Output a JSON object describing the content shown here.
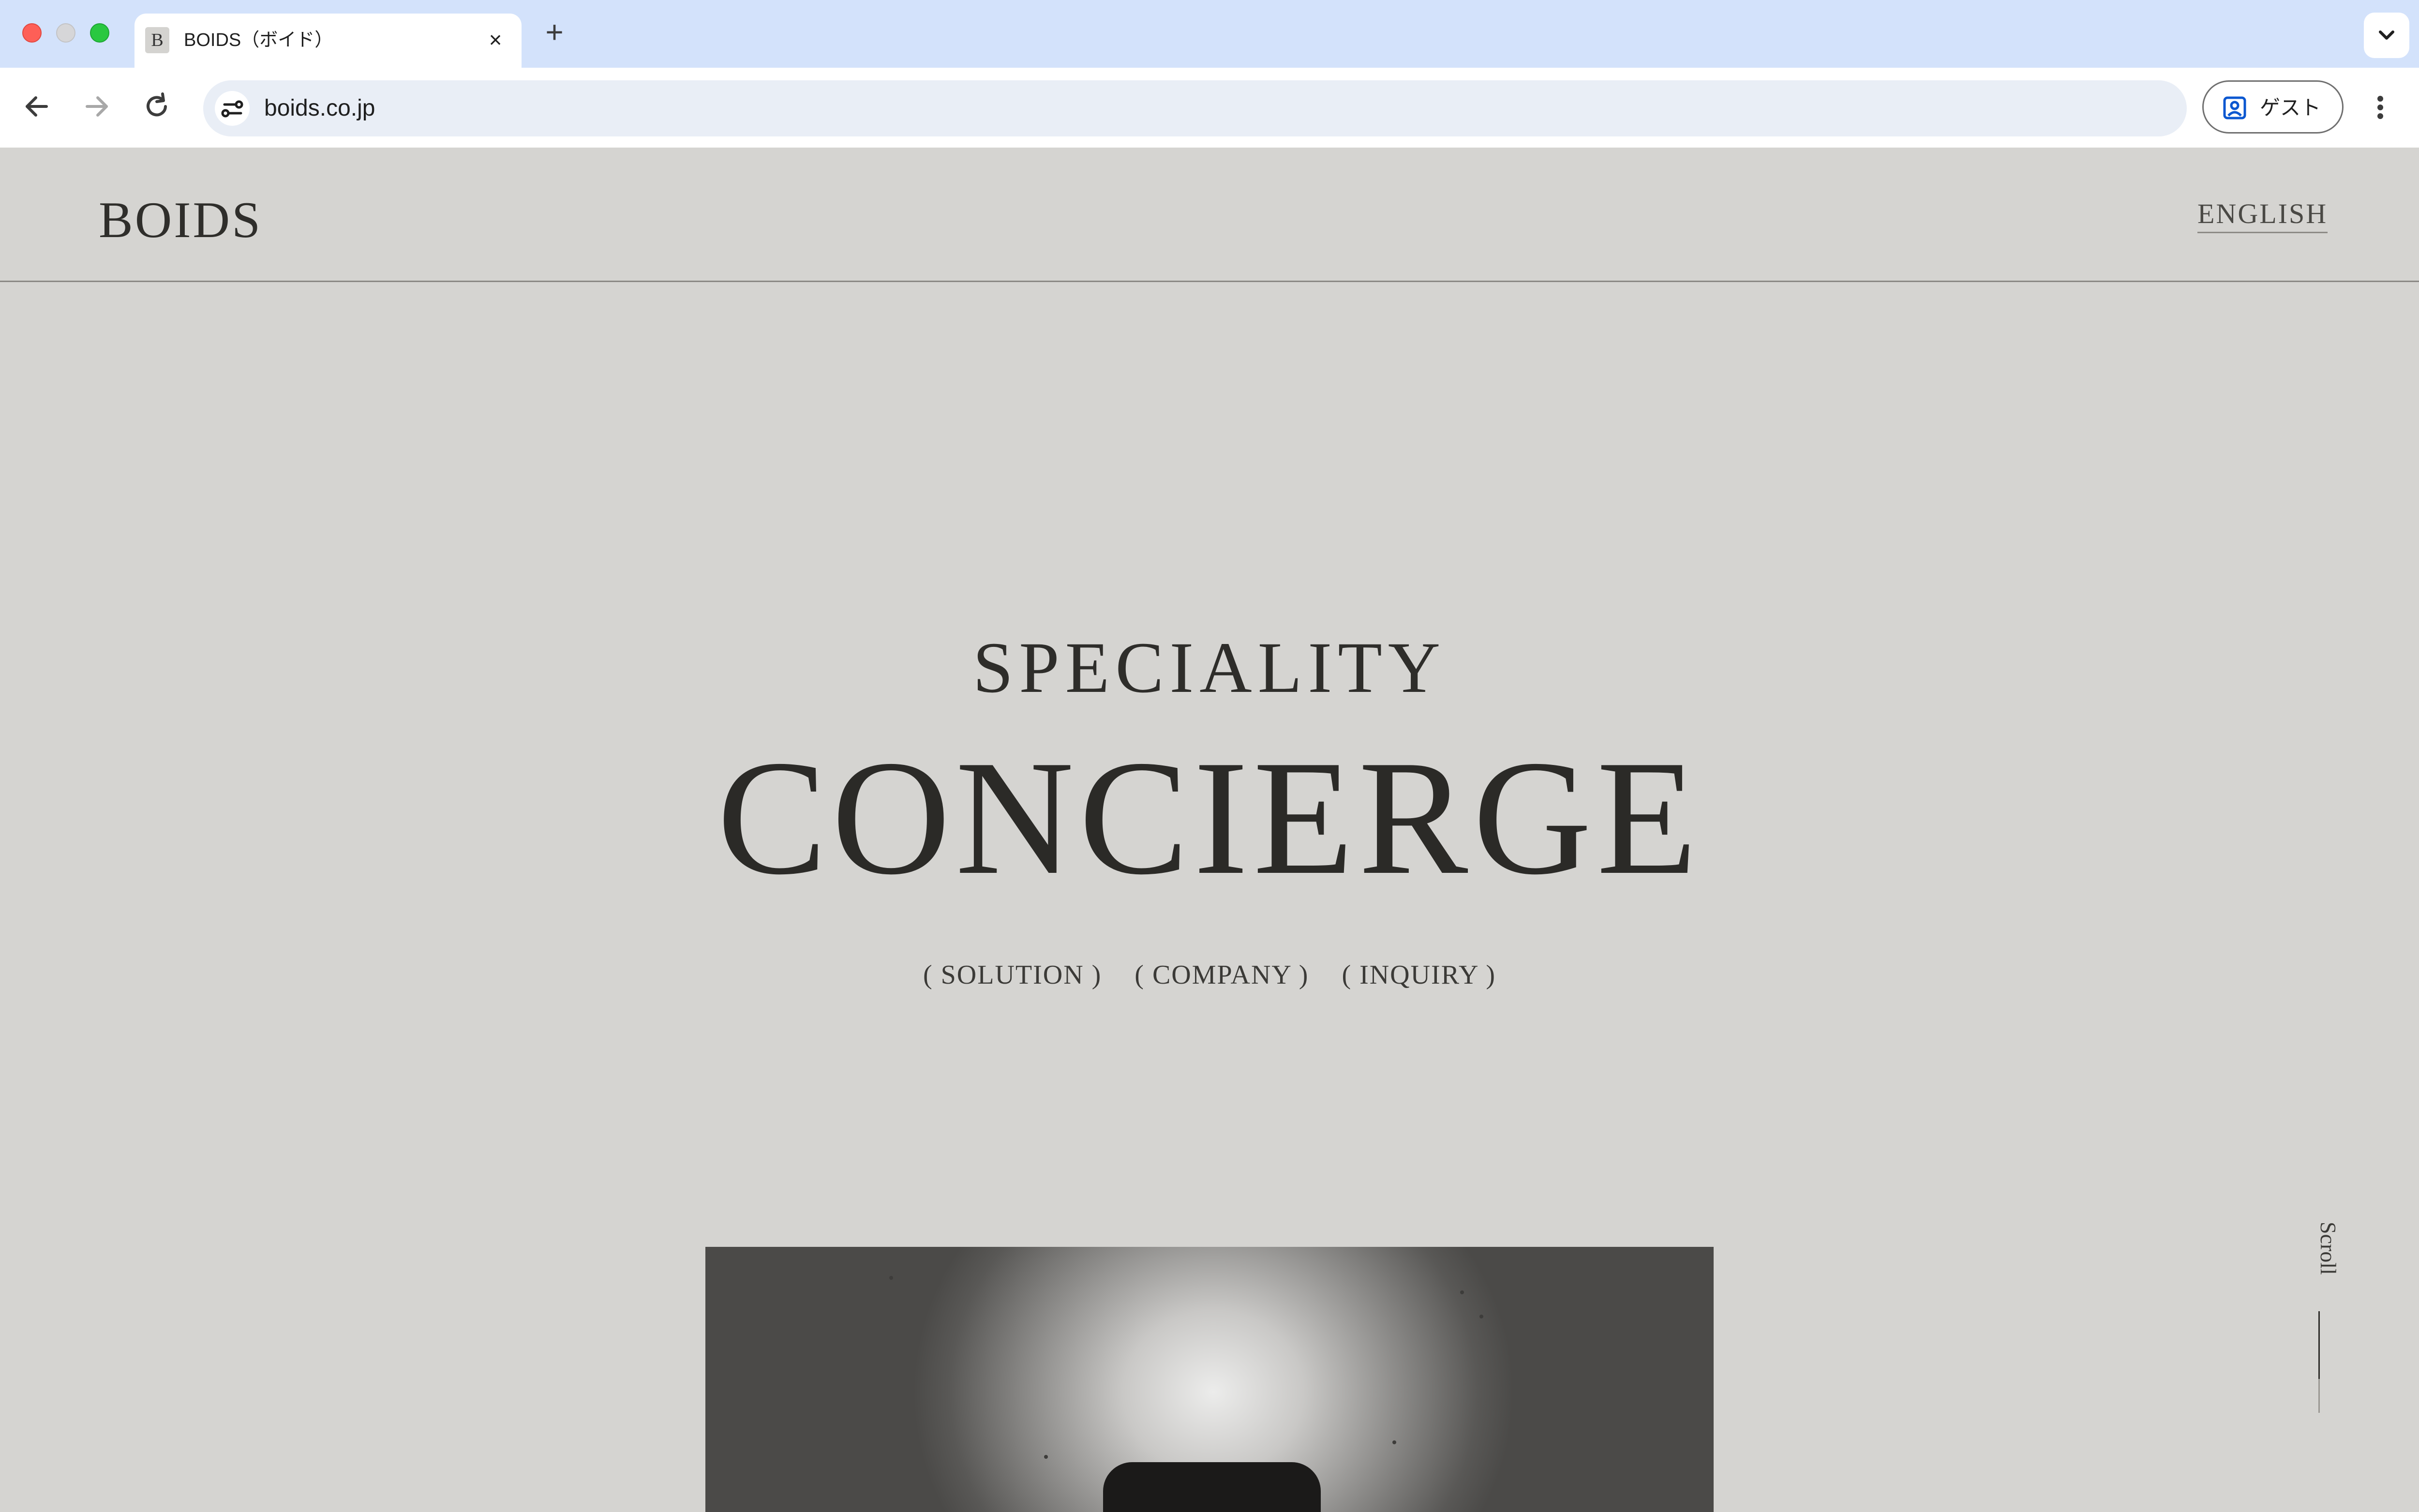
{
  "browser": {
    "tab_title": "BOIDS（ボイド）",
    "favicon_letter": "B",
    "url": "boids.co.jp",
    "guest_label": "ゲスト"
  },
  "header": {
    "logo": "BOIDS",
    "language_link": "ENGLISH"
  },
  "hero": {
    "subtitle": "SPECIALITY",
    "title": "CONCIERGE",
    "links": [
      "( SOLUTION )",
      "( COMPANY )",
      "( INQUIRY )"
    ]
  },
  "scroll_indicator": {
    "label": "Scroll"
  }
}
